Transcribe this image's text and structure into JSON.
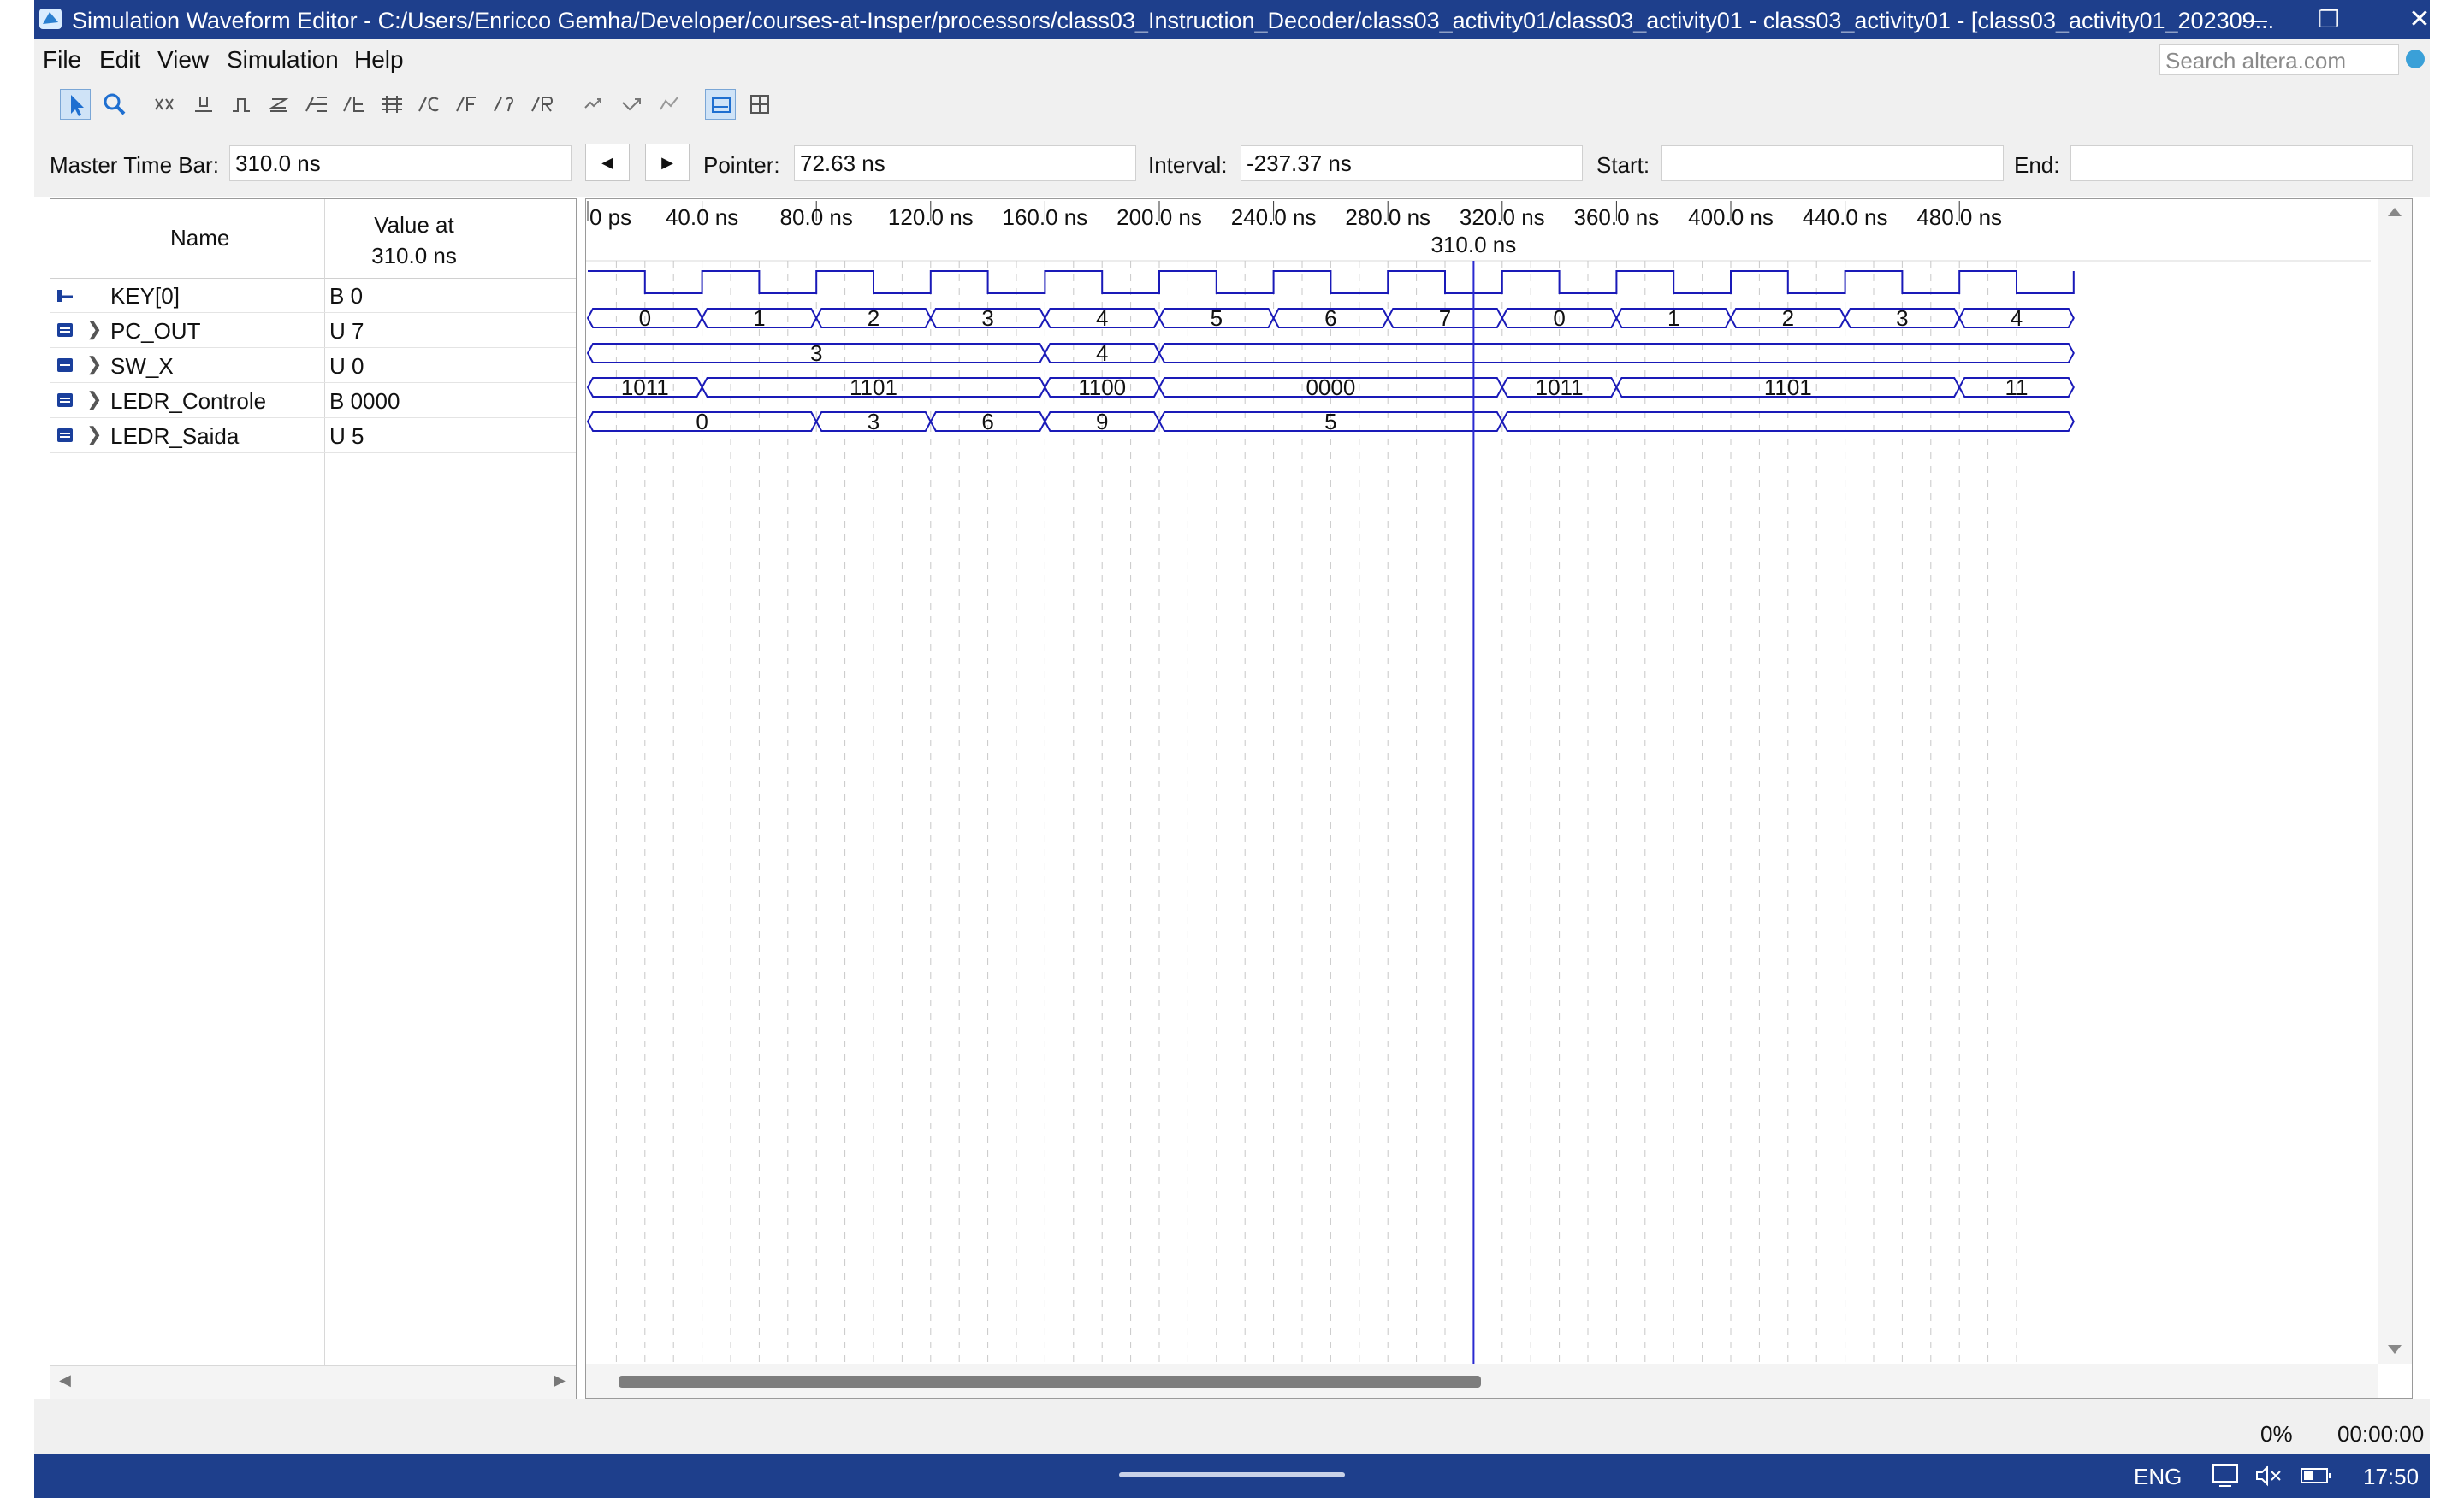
{
  "window": {
    "title": "Simulation Waveform Editor - C:/Users/Enricco Gemha/Developer/courses-at-Insper/processors/class03_Instruction_Decoder/class03_activity01/class03_activity01 - class03_activity01 - [class03_activity01_202309...",
    "minimize": "—",
    "restore": "❐",
    "close": "✕"
  },
  "menu": {
    "items": [
      "File",
      "Edit",
      "View",
      "Simulation",
      "Help"
    ],
    "search_placeholder": "Search altera.com"
  },
  "toolbar": {
    "icons": [
      "pointer-tool-icon",
      "zoom-tool-icon",
      "uninitialized-icon",
      "force-low-icon",
      "force-high-icon",
      "high-impedance-icon",
      "weak-low-icon",
      "weak-high-icon",
      "invert-icon",
      "count-value-icon",
      "clock-icon",
      "arbitrary-value-icon",
      "random-values-icon",
      "snap-to-grid-icon",
      "count-icon",
      "invert-selection-icon",
      "overwrite-icon",
      "grid-icon"
    ]
  },
  "timebar": {
    "master_label": "Master Time Bar:",
    "master_value": "310.0 ns",
    "pointer_label": "Pointer:",
    "pointer_value": "72.63 ns",
    "interval_label": "Interval:",
    "interval_value": "-237.37 ns",
    "start_label": "Start:",
    "start_value": "",
    "end_label": "End:",
    "end_value": ""
  },
  "signal_table": {
    "name_header": "Name",
    "value_header_1": "Value at",
    "value_header_2": "310.0 ns",
    "signals": [
      {
        "name": "KEY[0]",
        "value": "B 0",
        "expandable": false
      },
      {
        "name": "PC_OUT",
        "value": "U 7",
        "expandable": true
      },
      {
        "name": "SW_X",
        "value": "U 0",
        "expandable": true
      },
      {
        "name": "LEDR_Controle",
        "value": "B 0000",
        "expandable": true
      },
      {
        "name": "LEDR_Saida",
        "value": "U 5",
        "expandable": true
      }
    ]
  },
  "chart_data": {
    "type": "waveform",
    "time_unit": "ns",
    "visible_range": [
      0,
      500
    ],
    "ticks": [
      {
        "t": 0,
        "label": "0 ps"
      },
      {
        "t": 40,
        "label": "40.0 ns"
      },
      {
        "t": 80,
        "label": "80.0 ns"
      },
      {
        "t": 120,
        "label": "120.0 ns"
      },
      {
        "t": 160,
        "label": "160.0 ns"
      },
      {
        "t": 200,
        "label": "200.0 ns"
      },
      {
        "t": 240,
        "label": "240.0 ns"
      },
      {
        "t": 280,
        "label": "280.0 ns"
      },
      {
        "t": 320,
        "label": "320.0 ns"
      },
      {
        "t": 360,
        "label": "360.0 ns"
      },
      {
        "t": 400,
        "label": "400.0 ns"
      },
      {
        "t": 440,
        "label": "440.0 ns"
      },
      {
        "t": 480,
        "label": "480.0 ns"
      }
    ],
    "cursor": {
      "t": 310,
      "label": "310.0 ns"
    },
    "clock": {
      "name": "KEY[0]",
      "period": 40,
      "high_start": 0,
      "high_duration": 20
    },
    "buses": [
      {
        "name": "PC_OUT",
        "segments": [
          {
            "start": 0,
            "end": 40,
            "label": "0"
          },
          {
            "start": 40,
            "end": 80,
            "label": "1"
          },
          {
            "start": 80,
            "end": 120,
            "label": "2"
          },
          {
            "start": 120,
            "end": 160,
            "label": "3"
          },
          {
            "start": 160,
            "end": 200,
            "label": "4"
          },
          {
            "start": 200,
            "end": 240,
            "label": "5"
          },
          {
            "start": 240,
            "end": 280,
            "label": "6"
          },
          {
            "start": 280,
            "end": 320,
            "label": "7"
          },
          {
            "start": 320,
            "end": 360,
            "label": "0"
          },
          {
            "start": 360,
            "end": 400,
            "label": "1"
          },
          {
            "start": 400,
            "end": 440,
            "label": "2"
          },
          {
            "start": 440,
            "end": 480,
            "label": "3"
          },
          {
            "start": 480,
            "end": 520,
            "label": "4"
          }
        ]
      },
      {
        "name": "SW_X",
        "segments": [
          {
            "start": 0,
            "end": 160,
            "label": "3"
          },
          {
            "start": 160,
            "end": 200,
            "label": "4"
          },
          {
            "start": 200,
            "end": 520,
            "label": ""
          }
        ]
      },
      {
        "name": "LEDR_Controle",
        "segments": [
          {
            "start": 0,
            "end": 40,
            "label": "1011"
          },
          {
            "start": 40,
            "end": 160,
            "label": "1101"
          },
          {
            "start": 160,
            "end": 200,
            "label": "1100"
          },
          {
            "start": 200,
            "end": 320,
            "label": "0000"
          },
          {
            "start": 320,
            "end": 360,
            "label": "1011"
          },
          {
            "start": 360,
            "end": 480,
            "label": "1101"
          },
          {
            "start": 480,
            "end": 520,
            "label": "11"
          }
        ]
      },
      {
        "name": "LEDR_Saida",
        "segments": [
          {
            "start": 0,
            "end": 80,
            "label": "0"
          },
          {
            "start": 80,
            "end": 120,
            "label": "3"
          },
          {
            "start": 120,
            "end": 160,
            "label": "6"
          },
          {
            "start": 160,
            "end": 200,
            "label": "9"
          },
          {
            "start": 200,
            "end": 320,
            "label": "5"
          },
          {
            "start": 320,
            "end": 520,
            "label": ""
          }
        ]
      }
    ]
  },
  "status": {
    "progress": "0%",
    "elapsed": "00:00:00"
  },
  "taskbar": {
    "language": "ENG",
    "clock": "17:50"
  },
  "colors": {
    "titlebar": "#1e3f8c",
    "waveform": "#1a1ab8",
    "cursor": "#2a2ad0",
    "grid": "#c8c8c8"
  }
}
